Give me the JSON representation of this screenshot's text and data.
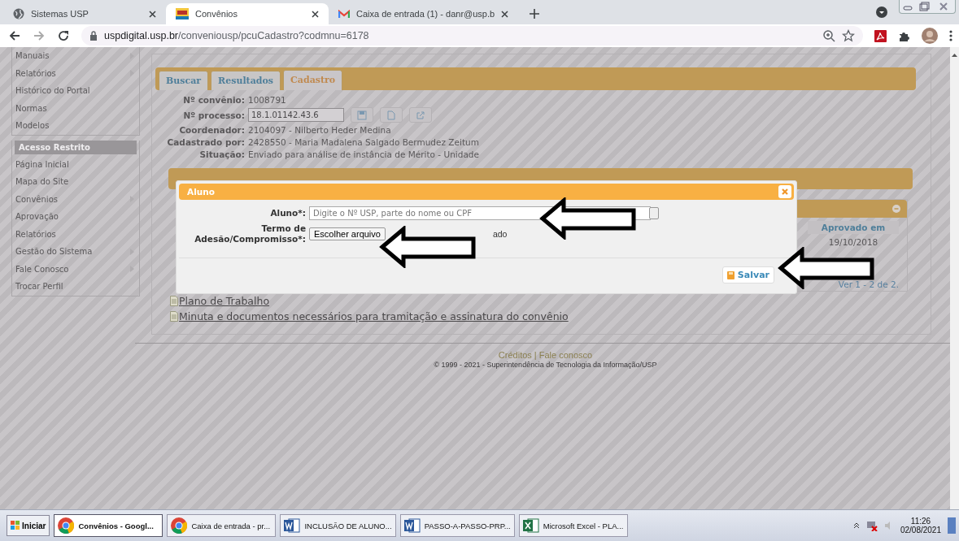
{
  "browser": {
    "tabs": [
      {
        "title": "Sistemas USP",
        "kind": "globe",
        "selected": false
      },
      {
        "title": "Convênios",
        "kind": "usp",
        "selected": true
      },
      {
        "title": "Caixa de entrada (1) - danr@usp.b",
        "kind": "mail",
        "selected": false
      }
    ],
    "url_host": "uspdigital.usp.br",
    "url_path": "/conveniousp/pcuCadastro?codmnu=6178"
  },
  "sidebar": {
    "groups": [
      {
        "items": [
          {
            "label": "Manuais",
            "has_submenu": true
          },
          {
            "label": "Relatórios",
            "has_submenu": true
          },
          {
            "label": "Histórico do Portal",
            "has_submenu": false
          },
          {
            "label": "Normas",
            "has_submenu": false
          },
          {
            "label": "Modelos",
            "has_submenu": false
          }
        ]
      },
      {
        "title": "Acesso Restrito",
        "items": [
          {
            "label": "Página Inicial",
            "has_submenu": false
          },
          {
            "label": "Mapa do Site",
            "has_submenu": false
          },
          {
            "label": "Convênios",
            "has_submenu": true
          },
          {
            "label": "Aprovação",
            "has_submenu": false
          },
          {
            "label": "Relatórios",
            "has_submenu": false
          },
          {
            "label": "Gestão do Sistema",
            "has_submenu": true
          },
          {
            "label": "Fale Conosco",
            "has_submenu": true
          },
          {
            "label": "Trocar Perfil",
            "has_submenu": false
          }
        ]
      }
    ]
  },
  "content": {
    "tabs": [
      {
        "label": "Buscar",
        "selected": false
      },
      {
        "label": "Resultados",
        "selected": false
      },
      {
        "label": "Cadastro",
        "selected": true
      }
    ],
    "fields": [
      {
        "kind": "text",
        "label": "Nº convênio:",
        "value": "1008791"
      },
      {
        "kind": "input",
        "label": "Nº processo:",
        "value": "18.1.01142.43.6"
      },
      {
        "kind": "text",
        "label": "Coordenador:",
        "value": "2104097 - Nilberto Heder Medina"
      },
      {
        "kind": "text",
        "label": "Cadastrado por:",
        "value": "2428550 - Maria Madalena Salgado Bermudez Zeitum"
      },
      {
        "kind": "text",
        "label": "Situação:",
        "value": "Enviado para análise de instância de Mérito - Unidade"
      }
    ],
    "table": {
      "column": "Aprovado em",
      "cell": "19/10/2018",
      "pager": "Ver 1 - 2 de 2."
    },
    "links": [
      " Plano de Trabalho",
      "Minuta e documentos necessários para tramitação e assinatura do convênio"
    ],
    "footer": {
      "links": [
        "Créditos",
        "Fale conosco"
      ],
      "separator": "|",
      "copyright": "© 1999 - 2021 - Superintendência de Tecnologia da Informação/USP"
    }
  },
  "modal": {
    "title": "Aluno",
    "student_label": "Aluno*:",
    "student_placeholder": "Digite o Nº USP, parte do nome ou CPF",
    "term_label_lines": [
      "Termo de",
      "Adesão/Compromisso*:"
    ],
    "file_button": "Escolher arquivo",
    "file_status": "ado",
    "save": "Salvar"
  },
  "taskbar": {
    "start": "Iniciar",
    "items": [
      {
        "label": "Convênios - Googl...",
        "kind": "chrome",
        "selected": true
      },
      {
        "label": "Caixa de entrada - pr...",
        "kind": "chrome",
        "selected": false
      },
      {
        "label": "INCLUSÃO DE ALUNO...",
        "kind": "word",
        "selected": false
      },
      {
        "label": "PASSO-A-PASSO-PRP...",
        "kind": "word",
        "selected": false
      },
      {
        "label": "Microsoft Excel - PLA...",
        "kind": "excel",
        "selected": false
      }
    ],
    "time": "11:26",
    "date": "02/08/2021"
  }
}
